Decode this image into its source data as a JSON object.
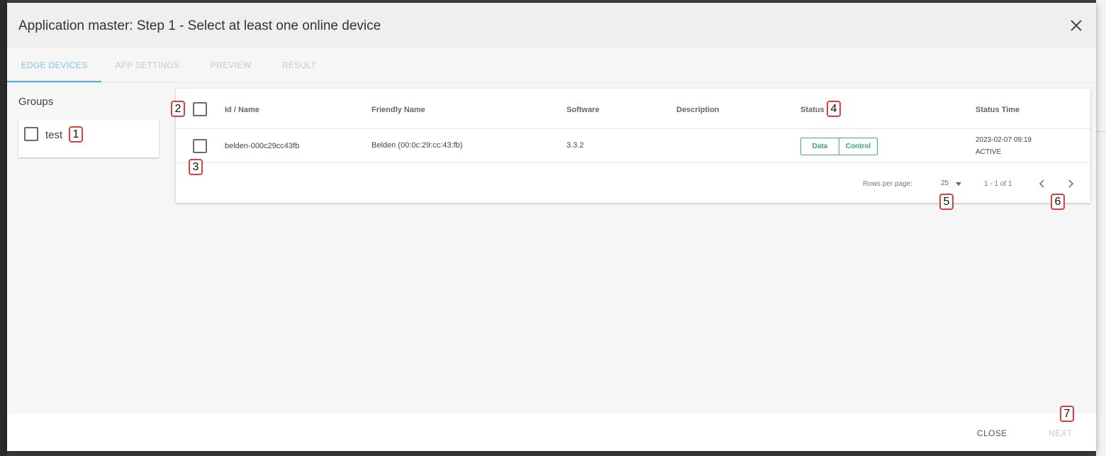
{
  "dialog": {
    "title": "Application master: Step 1 - Select at least one online device"
  },
  "tabs": [
    {
      "label": "EDGE DEVICES",
      "active": true
    },
    {
      "label": "APP SETTINGS",
      "active": false
    },
    {
      "label": "PREVIEW",
      "active": false
    },
    {
      "label": "RESULT",
      "active": false
    }
  ],
  "groups": {
    "title": "Groups",
    "items": [
      {
        "label": "test",
        "checked": false
      }
    ]
  },
  "table": {
    "columns": [
      "Id / Name",
      "Friendly Name",
      "Software",
      "Description",
      "Status",
      "Status Time"
    ],
    "rows": [
      {
        "id_name": "belden-000c29cc43fb",
        "friendly_name": "Belden (00:0c:29:cc:43:fb)",
        "software": "3.3.2",
        "description": "",
        "status": [
          "Data",
          "Control"
        ],
        "status_time": "2023-02-07 09:19",
        "status_state": "ACTIVE",
        "checked": false
      }
    ],
    "footer": {
      "rows_per_page_label": "Rows per page:",
      "rows_per_page_value": "25",
      "range": "1 - 1 of 1"
    }
  },
  "buttons": {
    "close": "CLOSE",
    "next": "NEXT"
  },
  "annotations": [
    "1",
    "2",
    "3",
    "4",
    "5",
    "6",
    "7"
  ],
  "colors": {
    "tab_active": "#7ec3e2",
    "chip_border": "#4caf7a",
    "badge_border": "#d94141"
  }
}
